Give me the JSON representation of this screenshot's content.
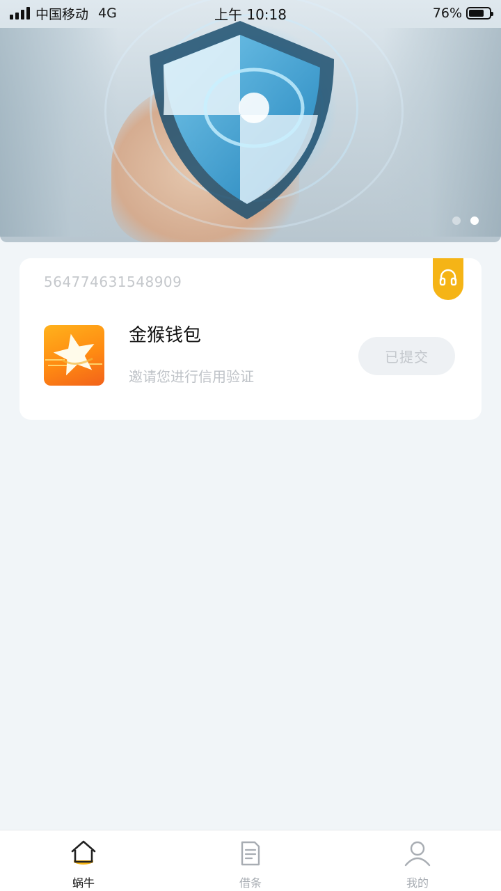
{
  "status_bar": {
    "carrier": "中国移动",
    "network": "4G",
    "time": "上午 10:18",
    "battery": "76%",
    "battery_level": 0.76
  },
  "banner": {
    "page_count": 2,
    "active_page": 2
  },
  "card": {
    "order_number": "564774631548909",
    "app_name": "金猴钱包",
    "description": "邀请您进行信用验证",
    "button_label": "已提交",
    "support_icon": "headset-icon",
    "logo_icon": "star-logo-icon"
  },
  "tab_bar": {
    "items": [
      {
        "label": "蜗牛",
        "icon": "home-icon",
        "active": true
      },
      {
        "label": "借条",
        "icon": "document-icon",
        "active": false
      },
      {
        "label": "我的",
        "icon": "user-icon",
        "active": false
      }
    ]
  },
  "colors": {
    "accent": "#f5b416",
    "background": "#f1f5f8",
    "logo_orange": "#ff8a12"
  }
}
